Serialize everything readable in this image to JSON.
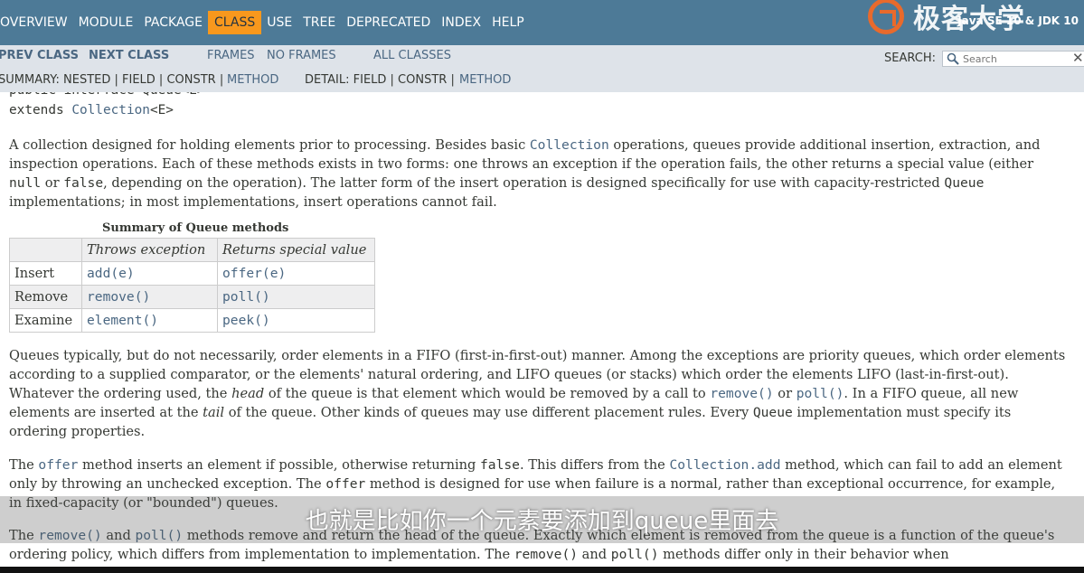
{
  "nav": {
    "items": [
      "OVERVIEW",
      "MODULE",
      "PACKAGE",
      "CLASS",
      "USE",
      "TREE",
      "DEPRECATED",
      "INDEX",
      "HELP"
    ],
    "active": "CLASS",
    "brand": "Java SE 10 & JDK 10",
    "watermark": "极客大学"
  },
  "subnav": {
    "prev_class": "PREV CLASS",
    "next_class": "NEXT CLASS",
    "frames": "FRAMES",
    "no_frames": "NO FRAMES",
    "all_classes": "ALL CLASSES",
    "search_label": "SEARCH:",
    "search_placeholder": "Search",
    "summary_prefix": "SUMMARY: NESTED | FIELD | CONSTR | ",
    "summary_method": "METHOD",
    "detail_prefix": "DETAIL: FIELD | CONSTR | ",
    "detail_method": "METHOD"
  },
  "signature": {
    "line1": "public interface Queue<E>",
    "extends_kw": "extends ",
    "extends_link": "Collection",
    "extends_suffix": "<E>"
  },
  "description": {
    "p1_a": "A collection designed for holding elements prior to processing. Besides basic ",
    "p1_link": "Collection",
    "p1_b": " operations, queues provide additional insertion, extraction, and inspection operations. Each of these methods exists in two forms: one throws an exception if the operation fails, the other returns a special value (either ",
    "p1_null": "null",
    "p1_c": " or ",
    "p1_false": "false",
    "p1_d": ", depending on the operation). The latter form of the insert operation is designed specifically for use with capacity-restricted ",
    "p1_queue": "Queue",
    "p1_e": " implementations; in most implementations, insert operations cannot fail.",
    "p2_a": "Queues typically, but do not necessarily, order elements in a FIFO (first-in-first-out) manner. Among the exceptions are priority queues, which order elements according to a supplied comparator, or the elements' natural ordering, and LIFO queues (or stacks) which order the elements LIFO (last-in-first-out). Whatever the ordering used, the ",
    "p2_head": "head",
    "p2_b": " of the queue is that element which would be removed by a call to ",
    "p2_remove": "remove()",
    "p2_c": " or ",
    "p2_poll": "poll()",
    "p2_d": ". In a FIFO queue, all new elements are inserted at the ",
    "p2_tail": "tail",
    "p2_e": " of the queue. Other kinds of queues may use different placement rules. Every ",
    "p2_queue": "Queue",
    "p2_f": " implementation must specify its ordering properties.",
    "p3_a": "The ",
    "p3_offer": "offer",
    "p3_b": " method inserts an element if possible, otherwise returning ",
    "p3_false": "false",
    "p3_c": ". This differs from the ",
    "p3_add": "Collection.add",
    "p3_d": " method, which can fail to add an element only by throwing an unchecked exception. The ",
    "p3_offer2": "offer",
    "p3_e": " method is designed for use when failure is a normal, rather than exceptional occurrence, for example, in fixed-capacity (or \"bounded\") queues.",
    "p4_a": "The ",
    "p4_remove": "remove()",
    "p4_b": " and ",
    "p4_poll": "poll()",
    "p4_c": " methods remove and return the head of the queue. Exactly which element is removed from the queue is a function of the queue's ordering policy, which differs from implementation to implementation. The ",
    "p4_remove2": "remove()",
    "p4_d": " and ",
    "p4_poll2": "poll()",
    "p4_e": " methods differ only in their behavior when"
  },
  "summary_table": {
    "caption": "Summary of Queue methods",
    "headers": [
      "",
      "Throws exception",
      "Returns special value"
    ],
    "rows": [
      {
        "op": "Insert",
        "throws": "add(e)",
        "special": "offer(e)"
      },
      {
        "op": "Remove",
        "throws": "remove()",
        "special": "poll()"
      },
      {
        "op": "Examine",
        "throws": "element()",
        "special": "peek()"
      }
    ]
  },
  "subtitle": "也就是比如你一个元素要添加到queue里面去"
}
